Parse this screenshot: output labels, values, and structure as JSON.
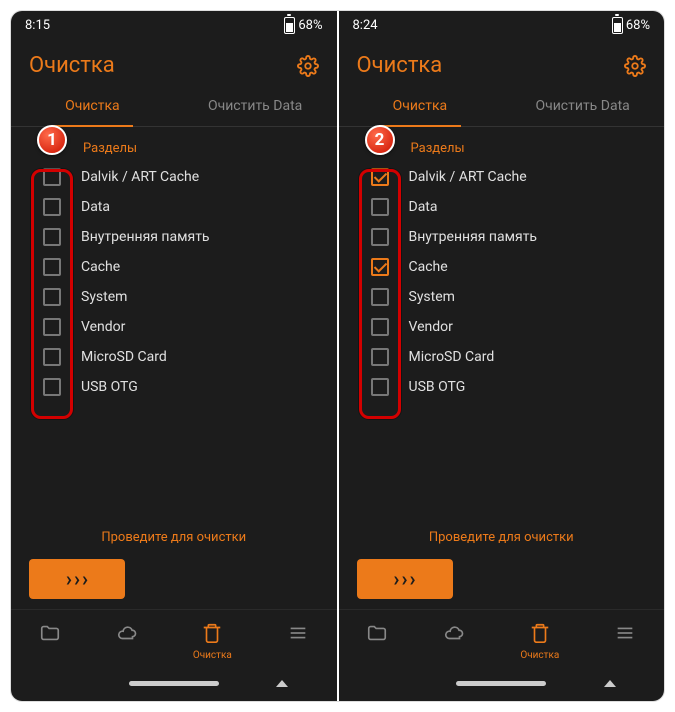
{
  "screens": [
    {
      "step": "1",
      "time": "8:15",
      "battery": "68%",
      "title": "Очистка",
      "tabs": {
        "clean": "Очистка",
        "cleardata": "Очистить Data"
      },
      "section_label": "Разделы",
      "items": [
        {
          "label": "Dalvik / ART Cache",
          "checked": false
        },
        {
          "label": "Data",
          "checked": false
        },
        {
          "label": "Внутренняя память",
          "checked": false
        },
        {
          "label": "Cache",
          "checked": false
        },
        {
          "label": "System",
          "checked": false
        },
        {
          "label": "Vendor",
          "checked": false
        },
        {
          "label": "MicroSD Card",
          "checked": false
        },
        {
          "label": "USB OTG",
          "checked": false
        }
      ],
      "swipe_label": "Проведите для очистки",
      "nav_active_label": "Очистка"
    },
    {
      "step": "2",
      "time": "8:24",
      "battery": "68%",
      "title": "Очистка",
      "tabs": {
        "clean": "Очистка",
        "cleardata": "Очистить Data"
      },
      "section_label": "Разделы",
      "items": [
        {
          "label": "Dalvik / ART Cache",
          "checked": true
        },
        {
          "label": "Data",
          "checked": false
        },
        {
          "label": "Внутренняя память",
          "checked": false
        },
        {
          "label": "Cache",
          "checked": true
        },
        {
          "label": "System",
          "checked": false
        },
        {
          "label": "Vendor",
          "checked": false
        },
        {
          "label": "MicroSD Card",
          "checked": false
        },
        {
          "label": "USB OTG",
          "checked": false
        }
      ],
      "swipe_label": "Проведите для очистки",
      "nav_active_label": "Очистка"
    }
  ]
}
